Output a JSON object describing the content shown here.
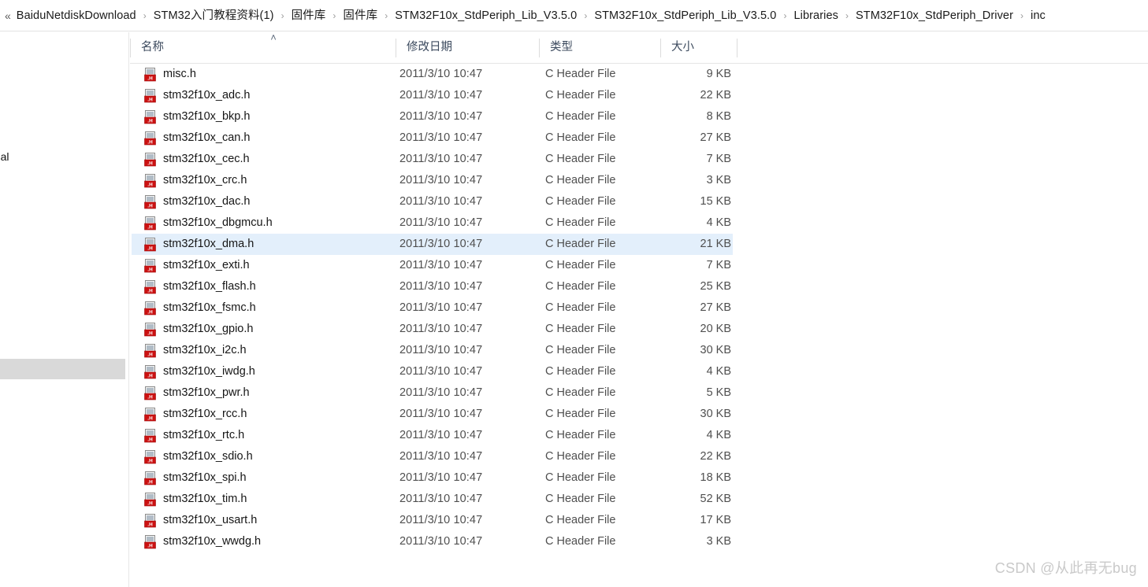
{
  "breadcrumb": {
    "overflow_glyph": "«",
    "separator": "›",
    "crumbs": [
      "BaiduNetdiskDownload",
      "STM32入门教程资料(1)",
      "固件库",
      "固件库",
      "STM32F10x_StdPeriph_Lib_V3.5.0",
      "STM32F10x_StdPeriph_Lib_V3.5.0",
      "Libraries",
      "STM32F10x_StdPeriph_Driver",
      "inc"
    ]
  },
  "nav_pane": {
    "clipped_label": "sonal"
  },
  "columns": {
    "name": "名称",
    "date_modified": "修改日期",
    "type": "类型",
    "size": "大小",
    "sort_arrow": "˄"
  },
  "icon": {
    "file_type_label": ".H",
    "band_color": "#cc1111",
    "page_color": "#d8d8d8"
  },
  "colors": {
    "selection": "#e3effb",
    "header_text": "#3c4a5e",
    "row_text": "#161616",
    "meta_text": "#4f4f4f"
  },
  "files": [
    {
      "name": "misc.h",
      "date": "2011/3/10 10:47",
      "type": "C Header File",
      "size": "9 KB",
      "selected": false
    },
    {
      "name": "stm32f10x_adc.h",
      "date": "2011/3/10 10:47",
      "type": "C Header File",
      "size": "22 KB",
      "selected": false
    },
    {
      "name": "stm32f10x_bkp.h",
      "date": "2011/3/10 10:47",
      "type": "C Header File",
      "size": "8 KB",
      "selected": false
    },
    {
      "name": "stm32f10x_can.h",
      "date": "2011/3/10 10:47",
      "type": "C Header File",
      "size": "27 KB",
      "selected": false
    },
    {
      "name": "stm32f10x_cec.h",
      "date": "2011/3/10 10:47",
      "type": "C Header File",
      "size": "7 KB",
      "selected": false
    },
    {
      "name": "stm32f10x_crc.h",
      "date": "2011/3/10 10:47",
      "type": "C Header File",
      "size": "3 KB",
      "selected": false
    },
    {
      "name": "stm32f10x_dac.h",
      "date": "2011/3/10 10:47",
      "type": "C Header File",
      "size": "15 KB",
      "selected": false
    },
    {
      "name": "stm32f10x_dbgmcu.h",
      "date": "2011/3/10 10:47",
      "type": "C Header File",
      "size": "4 KB",
      "selected": false
    },
    {
      "name": "stm32f10x_dma.h",
      "date": "2011/3/10 10:47",
      "type": "C Header File",
      "size": "21 KB",
      "selected": true
    },
    {
      "name": "stm32f10x_exti.h",
      "date": "2011/3/10 10:47",
      "type": "C Header File",
      "size": "7 KB",
      "selected": false
    },
    {
      "name": "stm32f10x_flash.h",
      "date": "2011/3/10 10:47",
      "type": "C Header File",
      "size": "25 KB",
      "selected": false
    },
    {
      "name": "stm32f10x_fsmc.h",
      "date": "2011/3/10 10:47",
      "type": "C Header File",
      "size": "27 KB",
      "selected": false
    },
    {
      "name": "stm32f10x_gpio.h",
      "date": "2011/3/10 10:47",
      "type": "C Header File",
      "size": "20 KB",
      "selected": false
    },
    {
      "name": "stm32f10x_i2c.h",
      "date": "2011/3/10 10:47",
      "type": "C Header File",
      "size": "30 KB",
      "selected": false
    },
    {
      "name": "stm32f10x_iwdg.h",
      "date": "2011/3/10 10:47",
      "type": "C Header File",
      "size": "4 KB",
      "selected": false
    },
    {
      "name": "stm32f10x_pwr.h",
      "date": "2011/3/10 10:47",
      "type": "C Header File",
      "size": "5 KB",
      "selected": false
    },
    {
      "name": "stm32f10x_rcc.h",
      "date": "2011/3/10 10:47",
      "type": "C Header File",
      "size": "30 KB",
      "selected": false
    },
    {
      "name": "stm32f10x_rtc.h",
      "date": "2011/3/10 10:47",
      "type": "C Header File",
      "size": "4 KB",
      "selected": false
    },
    {
      "name": "stm32f10x_sdio.h",
      "date": "2011/3/10 10:47",
      "type": "C Header File",
      "size": "22 KB",
      "selected": false
    },
    {
      "name": "stm32f10x_spi.h",
      "date": "2011/3/10 10:47",
      "type": "C Header File",
      "size": "18 KB",
      "selected": false
    },
    {
      "name": "stm32f10x_tim.h",
      "date": "2011/3/10 10:47",
      "type": "C Header File",
      "size": "52 KB",
      "selected": false
    },
    {
      "name": "stm32f10x_usart.h",
      "date": "2011/3/10 10:47",
      "type": "C Header File",
      "size": "17 KB",
      "selected": false
    },
    {
      "name": "stm32f10x_wwdg.h",
      "date": "2011/3/10 10:47",
      "type": "C Header File",
      "size": "3 KB",
      "selected": false
    }
  ],
  "watermark": {
    "text": "CSDN @从此再无bug"
  }
}
